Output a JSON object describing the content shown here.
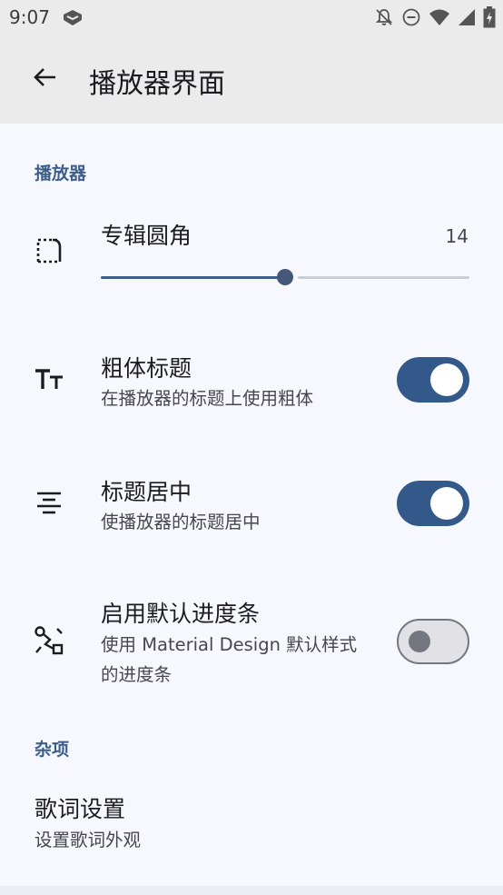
{
  "status_bar": {
    "time": "9:07",
    "icons": [
      "app-notification-icon",
      "bell-off-icon",
      "do-not-disturb-icon",
      "wifi-icon",
      "cellular-icon",
      "battery-charging-icon"
    ]
  },
  "app_bar": {
    "title": "播放器界面",
    "back_icon": "arrow-back-icon"
  },
  "sections": {
    "player": {
      "header": "播放器",
      "album_corner": {
        "icon": "rounded-corner-icon",
        "title": "专辑圆角",
        "value": "14",
        "slider_fraction": 0.5
      },
      "bold_title": {
        "icon": "text-size-icon",
        "title": "粗体标题",
        "subtitle": "在播放器的标题上使用粗体",
        "enabled": true
      },
      "center_title": {
        "icon": "align-center-icon",
        "title": "标题居中",
        "subtitle": "使播放器的标题居中",
        "enabled": true
      },
      "default_progress": {
        "icon": "progress-route-icon",
        "title": "启用默认进度条",
        "subtitle": "使用 Material Design 默认样式的进度条",
        "enabled": false
      }
    },
    "misc": {
      "header": "杂项",
      "lyrics": {
        "title": "歌词设置",
        "subtitle": "设置歌词外观"
      }
    }
  },
  "colors": {
    "accent": "#3d5e8a",
    "switch_on": "#33598a",
    "background": "#f6f8fd",
    "app_bar": "#ebebeb"
  }
}
